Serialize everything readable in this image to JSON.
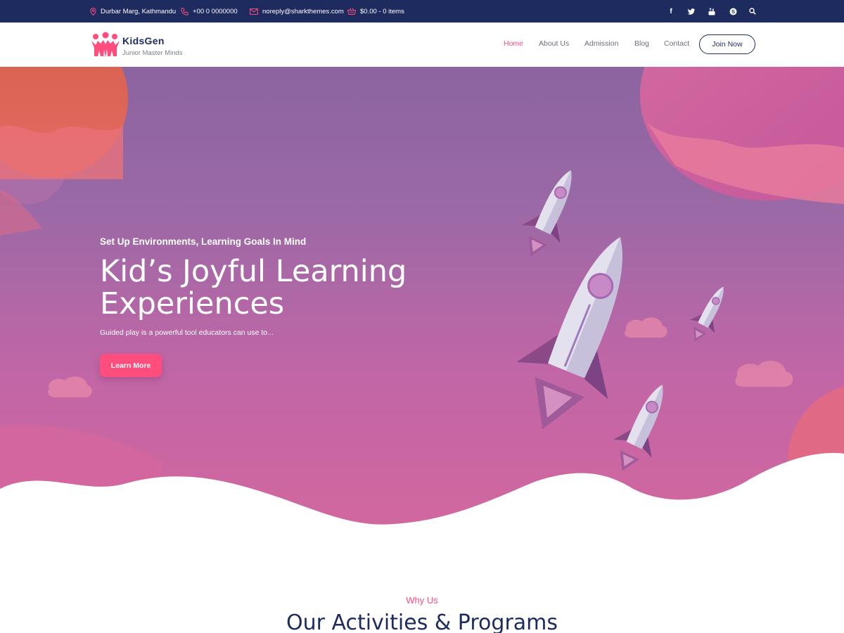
{
  "topbar": {
    "address": "Durbar Marg, Kathmandu",
    "phone": "+00 0 0000000",
    "email": "noreply@sharkthemes.com",
    "cart": "$0.00 - 0 items",
    "social_icons": [
      "facebook-icon",
      "twitter-icon",
      "youtube-icon",
      "skype-icon",
      "search-icon"
    ]
  },
  "brand": {
    "name": "KidsGen",
    "tagline": "Junior Master Minds"
  },
  "nav": {
    "items": [
      {
        "label": "Home",
        "active": true
      },
      {
        "label": "About Us",
        "active": false
      },
      {
        "label": "Admission",
        "active": false
      },
      {
        "label": "Blog",
        "active": false
      },
      {
        "label": "Contact",
        "active": false
      }
    ],
    "join_label": "Join Now"
  },
  "hero": {
    "subtitle": "Set Up Environments, Learning Goals In Mind",
    "title": "Kid’s Joyful Learning Experiences",
    "description": "Guided play is a powerful tool educators can use to...",
    "button_label": "Learn More"
  },
  "section": {
    "eyebrow": "Why Us",
    "title": "Our Activities & Programs"
  },
  "colors": {
    "navy": "#1e2b5e",
    "accent": "#ff4d7e",
    "hero_top": "#8c64a0",
    "hero_bottom": "#d2679f"
  }
}
